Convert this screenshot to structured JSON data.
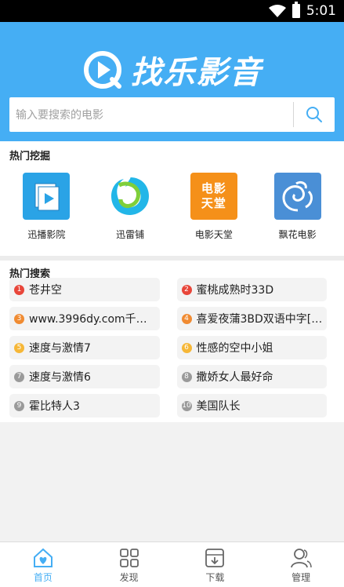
{
  "status": {
    "time": "5:01"
  },
  "header": {
    "app_name": "找乐影音"
  },
  "search": {
    "placeholder": "输入要搜索的电影"
  },
  "hot_apps": {
    "title": "热门挖掘",
    "items": [
      {
        "label": "迅播影院",
        "icon": "video-play-icon",
        "color": "#2aa3e6"
      },
      {
        "label": "迅雷铺",
        "icon": "thunder-swirl-icon",
        "color": "#22b6e8"
      },
      {
        "label": "电影天堂",
        "icon": "movie-heaven-icon",
        "color": "#f59019",
        "icon_text": "电影天堂"
      },
      {
        "label": "飘花电影",
        "icon": "swirl-flower-icon",
        "color": "#4a8fd6"
      }
    ]
  },
  "hot_search": {
    "title": "热门搜索",
    "items": [
      {
        "rank": "1",
        "text": "苍井空",
        "color": "#e8463a"
      },
      {
        "rank": "2",
        "text": "蜜桃成熟时33D",
        "color": "#e8463a"
      },
      {
        "rank": "3",
        "text": "www.3996dy.com千…",
        "color": "#f08b32"
      },
      {
        "rank": "4",
        "text": "喜爱夜蒲3BD双语中字[…",
        "color": "#f08b32"
      },
      {
        "rank": "5",
        "text": "速度与激情7",
        "color": "#f6b737"
      },
      {
        "rank": "6",
        "text": "性感的空中小姐",
        "color": "#f6b737"
      },
      {
        "rank": "7",
        "text": "速度与激情6",
        "color": "#9a9a9a"
      },
      {
        "rank": "8",
        "text": "撒娇女人最好命",
        "color": "#9a9a9a"
      },
      {
        "rank": "9",
        "text": "霍比特人3",
        "color": "#9a9a9a"
      },
      {
        "rank": "10",
        "text": "美国队长",
        "color": "#9a9a9a"
      }
    ]
  },
  "tabs": [
    {
      "label": "首页",
      "icon": "home-icon",
      "active": true
    },
    {
      "label": "发现",
      "icon": "grid-icon",
      "active": false
    },
    {
      "label": "下载",
      "icon": "download-icon",
      "active": false
    },
    {
      "label": "管理",
      "icon": "user-icon",
      "active": false
    }
  ]
}
